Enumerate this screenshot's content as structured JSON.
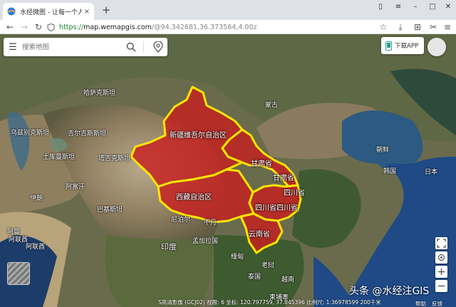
{
  "browser": {
    "tab_title": "水经微图 - 让每一个人都有自",
    "tab_close": "×",
    "new_tab": "+",
    "url_scheme": "https://",
    "url_host": "map.wemapgis.com",
    "url_path": "/@94.342681,36.373564,4.00z"
  },
  "map": {
    "search_placeholder": "搜索地图",
    "download_app": "下载APP",
    "status": "S高清影像 (GCJ02)    视眼: 6    坐标:    120.797759, 37.845396    比例尺: 1:36978599    200千米",
    "watermark": "头条 @水经注GIS",
    "help": "帮助",
    "feedback": "反馈",
    "region_fill": "#c81e1e",
    "region_border": "#ffe600"
  },
  "places": {
    "kazakhstan": "哈萨克斯坦",
    "uzbekistan": "乌兹别克斯坦",
    "kyrgyzstan": "吉尔吉斯斯坦",
    "turkmenistan": "土库曼斯坦",
    "tajikistan": "塔吉克斯坦",
    "afghanistan": "阿富汗",
    "iran": "伊朗",
    "pakistan": "巴基斯坦",
    "mongolia": "蒙古",
    "india": "印度",
    "bangladesh": "孟加拉国",
    "myanmar": "缅甸",
    "laos": "老挝",
    "thailand": "泰国",
    "cambodia": "柬埔寨",
    "vietnam": "越南",
    "north_korea": "朝鲜",
    "south_korea": "韩国",
    "japan": "日本",
    "oman": "阿曼",
    "nepal": "尼泊尔",
    "bhutan": "不丹",
    "uae": "阿联酋",
    "uae2": "阿联酋",
    "xinjiang": "新疆维吾尔自治区",
    "tibet": "西藏自治区",
    "gansu1": "甘肃省",
    "gansu2": "甘肃省",
    "sichuan1": "四川省",
    "sichuan2": "四川省四川省",
    "yunnan": "云南省"
  }
}
